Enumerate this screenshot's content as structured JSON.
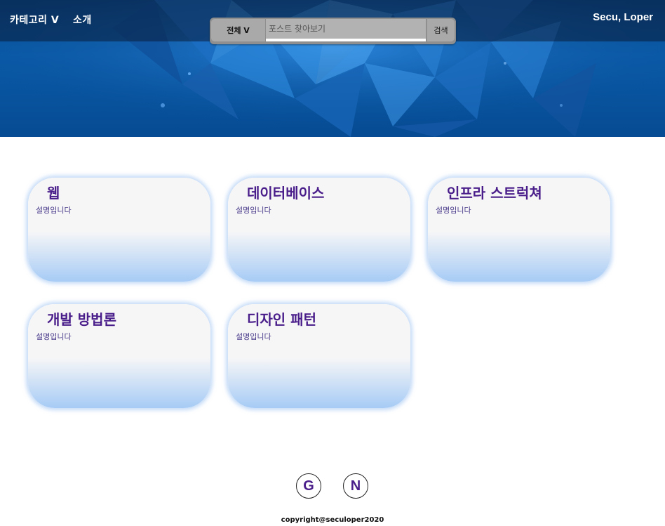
{
  "header": {
    "nav": {
      "category_label": "카테고리 V",
      "about_label": "소개"
    },
    "brand": "Secu, Loper",
    "search": {
      "scope_label": "전체 V",
      "placeholder": "포스트 찾아보기",
      "button_label": "검색"
    }
  },
  "categories": [
    {
      "title": "웹",
      "description": "설명입니다"
    },
    {
      "title": "데이터베이스",
      "description": "설명입니다"
    },
    {
      "title": "인프라 스트럭쳐",
      "description": "설명입니다"
    },
    {
      "title": "개발 방법론",
      "description": "설명입니다"
    },
    {
      "title": "디자인 패턴",
      "description": "설명입니다"
    }
  ],
  "footer": {
    "social": {
      "github_letter": "G",
      "naver_letter": "N"
    },
    "copyright": "copyright@seculoper2020"
  },
  "colors": {
    "title_purple": "#4a1e8a",
    "hero_blue": "#0a5aa8",
    "card_gradient_bottom": "#a6cbf5"
  }
}
